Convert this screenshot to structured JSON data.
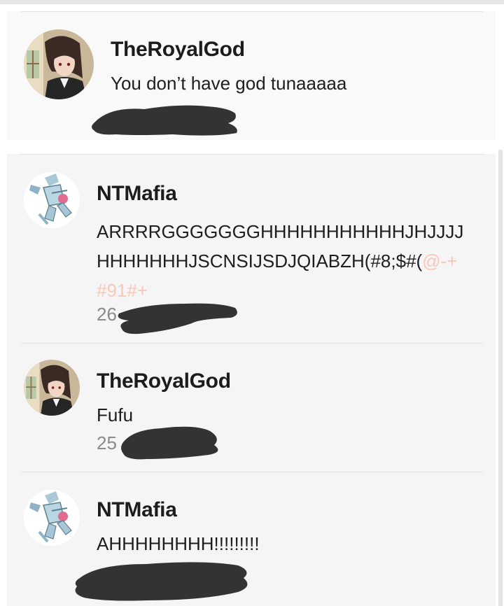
{
  "comments": [
    {
      "username": "TheRoyalGod",
      "message_lines": [
        "You don’t have god tunaaaaa"
      ],
      "timestamp": "",
      "avatar": "anime-character-avatar-icon",
      "background": "#f9f9f9"
    },
    {
      "username": "NTMafia",
      "message_lines": [
        "ARRRRGGGGGGGHHHHHHHHHHHJHJJJJ",
        "HHHHHHHJSCNSIJSDJQIABZH(#8;$#("
      ],
      "message_faint": [
        "@-+",
        "#91#+"
      ],
      "timestamp": "26",
      "avatar": "robot-mech-avatar-icon",
      "background": "#f5f5f5"
    },
    {
      "username": "TheRoyalGod",
      "message_lines": [
        "Fufu"
      ],
      "timestamp": "25",
      "avatar": "anime-character-avatar-icon",
      "background": "#f5f5f5"
    },
    {
      "username": "NTMafia",
      "message_lines": [
        "AHHHHHHHH!!!!!!!!!"
      ],
      "timestamp": "",
      "avatar": "robot-mech-avatar-icon",
      "background": "#f5f5f5"
    }
  ],
  "colors": {
    "username": "#1c1c1c",
    "message": "#1e1e1e",
    "timestamp": "#8a8a8a",
    "faint_text": "#f7c8b8",
    "redaction": "#333333"
  }
}
